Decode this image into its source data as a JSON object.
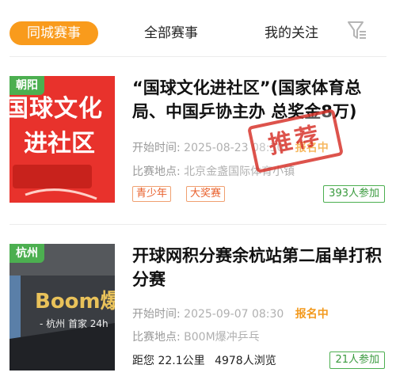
{
  "tabs": {
    "local": "同城赛事",
    "all": "全部赛事",
    "follow": "我的关注"
  },
  "colors": {
    "accent": "#f99b1c",
    "city_badge": "#4caf50",
    "stamp": "#d8362d"
  },
  "events": [
    {
      "city": "朝阳",
      "title": "“国球文化进社区”(国家体育总局、中国乒协主办 总奖金8万)",
      "start_label": "开始时间:",
      "start_value": "2025-08-23 08:30",
      "status": "报名中",
      "venue_label": "比赛地点:",
      "venue_value": "北京金盏国际体育小镇",
      "tags": [
        "青少年",
        "大奖赛"
      ],
      "participants": "393人参加",
      "stamp": "推荐",
      "thumb_text": [
        "国球文化",
        "进社区"
      ]
    },
    {
      "city": "杭州",
      "title": "开球网积分赛余杭站第二届单打积分赛",
      "start_label": "开始时间:",
      "start_value": "2025-09-07 08:30",
      "status": "报名中",
      "venue_label": "比赛地点:",
      "venue_value": "B00M爆冲乒乓",
      "distance": "距您 22.1公里",
      "views": "4978人浏览",
      "participants": "21人参加",
      "thumb_text": [
        "Boom爆",
        "- 杭州 首家 24h"
      ]
    }
  ]
}
